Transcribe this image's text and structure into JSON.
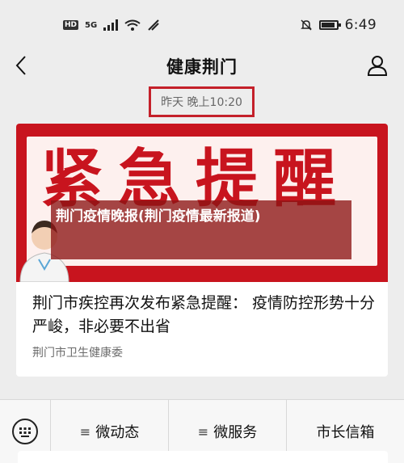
{
  "status_bar": {
    "hd": "HD",
    "network": "5G",
    "time": "6:49"
  },
  "nav": {
    "title": "健康荆门"
  },
  "date_stamp": "昨天 晚上10:20",
  "article": {
    "banner_stamp": "紧急提醒",
    "banner_overlay": "荆门疫情晚报(荆门疫情最新报道)",
    "title": "荆门市疾控再次发布紧急提醒： 疫情防控形势十分严峻，非必要不出省",
    "source": "荆门市卫生健康委"
  },
  "bottom_menu": {
    "items": [
      {
        "prefix": "≡",
        "label": "微动态"
      },
      {
        "prefix": "≡",
        "label": "微服务"
      },
      {
        "prefix": "",
        "label": "市长信箱"
      }
    ]
  },
  "colors": {
    "accent_red": "#c8141e",
    "date_border": "#c4202a"
  }
}
